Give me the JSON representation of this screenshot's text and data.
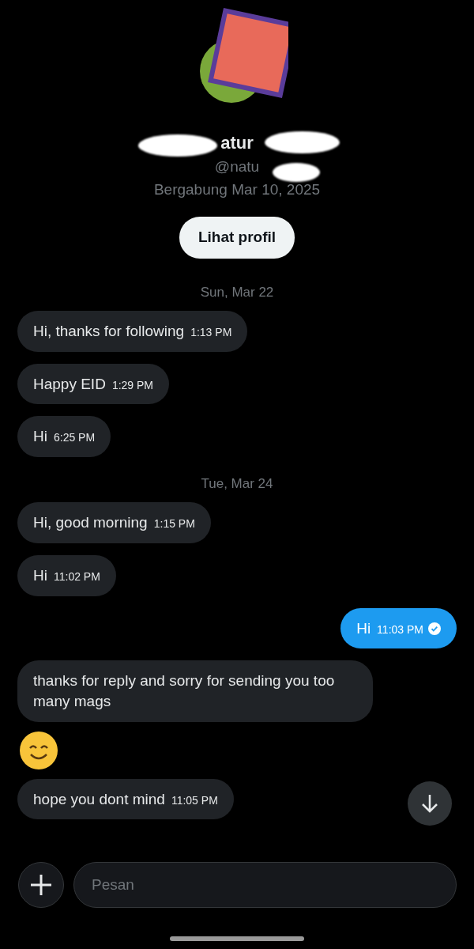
{
  "profile": {
    "name": "atur",
    "handle": "@natu",
    "joined": "Bergabung Mar 10, 2025",
    "button": "Lihat profil"
  },
  "messages": [
    {
      "kind": "date",
      "text": "Sun, Mar 22"
    },
    {
      "kind": "in",
      "text": "Hi, thanks for following",
      "time": "1:13 PM"
    },
    {
      "kind": "in",
      "text": "Happy EID",
      "time": "1:29 PM"
    },
    {
      "kind": "in",
      "text": "Hi",
      "time": "6:25 PM"
    },
    {
      "kind": "date",
      "text": "Tue, Mar 24"
    },
    {
      "kind": "in",
      "text": "Hi, good morning",
      "time": "1:15 PM"
    },
    {
      "kind": "in",
      "text": "Hi",
      "time": "11:02 PM"
    },
    {
      "kind": "out",
      "text": "Hi",
      "time": "11:03 PM",
      "read": true
    },
    {
      "kind": "in",
      "text": "thanks for reply and sorry for sending you too many mags"
    },
    {
      "kind": "emoji"
    },
    {
      "kind": "in",
      "text": "hope you dont mind",
      "time": "11:05 PM"
    }
  ],
  "composer": {
    "placeholder": "Pesan"
  }
}
